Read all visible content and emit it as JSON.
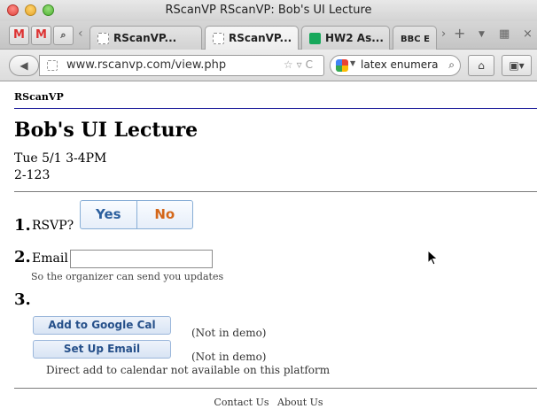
{
  "window": {
    "title": "RScanVP RScanVP: Bob's UI Lecture"
  },
  "pinned_tabs": [
    {
      "glyph": "M",
      "icon": "gmail-icon"
    },
    {
      "glyph": "M",
      "icon": "gmail-icon"
    },
    {
      "glyph": "⌕",
      "icon": "app-icon"
    }
  ],
  "tabs": [
    {
      "label": "RScanVP...",
      "active": false,
      "icon": "page-icon"
    },
    {
      "label": "RScanVP...",
      "active": true,
      "icon": "page-icon"
    },
    {
      "label": "HW2 As...",
      "active": false,
      "icon": "sheets-icon"
    },
    {
      "label": "BBC E",
      "active": false,
      "icon": "bbc-icon"
    }
  ],
  "toolbar": {
    "url": "www.rscanvp.com/view.php",
    "search_query": "latex enumera",
    "back_glyph": "◀",
    "home_glyph": "⌂",
    "bookmarks_glyph": "▣▾"
  },
  "page": {
    "brand": "RScanVP",
    "event_title": "Bob's UI Lecture",
    "event_time": "Tue 5/1 3-4PM",
    "event_room": "2-123",
    "step1": {
      "number": "1.",
      "label": "RSVP?",
      "yes": "Yes",
      "no": "No"
    },
    "step2": {
      "number": "2.",
      "label": "Email",
      "value": "",
      "hint": "So the organizer can send you updates"
    },
    "step3": {
      "number": "3.",
      "add_calendar": "Add to Google Cal",
      "add_calendar_note": "(Not in demo)",
      "setup_email": "Set Up Email",
      "setup_email_note": "(Not in demo)",
      "platform_note": "Direct add to calendar not available on this platform"
    },
    "footer": {
      "contact": "Contact Us",
      "about": "About Us"
    }
  },
  "colors": {
    "accent": "#2b5f9e",
    "no_button": "#d4671a",
    "brand_rule": "#1a1a9a"
  }
}
